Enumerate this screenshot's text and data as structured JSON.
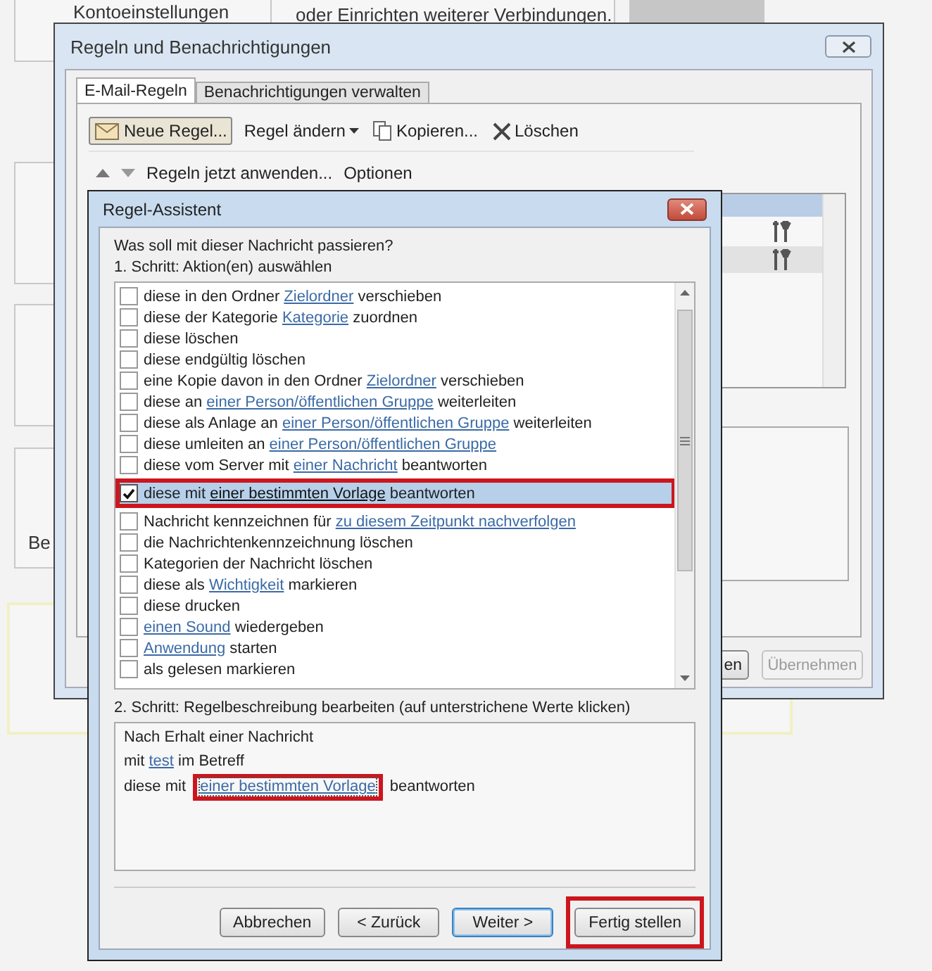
{
  "background": {
    "account_settings": "Kontoeinstellungen",
    "connections_text": "oder Einrichten weiterer Verbindungen.",
    "partial_label": "Be"
  },
  "rules_window": {
    "title": "Regeln und Benachrichtigungen",
    "tabs": [
      {
        "label": "E-Mail-Regeln",
        "selected": true
      },
      {
        "label": "Benachrichtigungen verwalten",
        "selected": false
      }
    ],
    "toolbar": [
      {
        "label": "Neue Regel...",
        "kind": "new"
      },
      {
        "label": "Regel ändern",
        "kind": "dropdown"
      },
      {
        "label": "Kopieren...",
        "kind": "copy"
      },
      {
        "label": "Löschen",
        "kind": "delete"
      }
    ],
    "commands": [
      "Regeln jetzt anwenden...",
      "Optionen"
    ],
    "buttons": [
      {
        "label": "en",
        "disabled": false
      },
      {
        "label": "Übernehmen",
        "disabled": true
      }
    ]
  },
  "wizard": {
    "title": "Regel-Assistent",
    "question": "Was soll mit dieser Nachricht passieren?",
    "step1": "1. Schritt: Aktion(en) auswählen",
    "actions": [
      {
        "checked": false,
        "selected": false,
        "highlighted": false,
        "parts": [
          {
            "text": "diese in den Ordner ",
            "link": false
          },
          {
            "text": "Zielordner",
            "link": true
          },
          {
            "text": " verschieben",
            "link": false
          }
        ]
      },
      {
        "checked": false,
        "selected": false,
        "highlighted": false,
        "parts": [
          {
            "text": "diese der Kategorie ",
            "link": false
          },
          {
            "text": "Kategorie",
            "link": true
          },
          {
            "text": " zuordnen",
            "link": false
          }
        ]
      },
      {
        "checked": false,
        "selected": false,
        "highlighted": false,
        "parts": [
          {
            "text": "diese löschen",
            "link": false
          }
        ]
      },
      {
        "checked": false,
        "selected": false,
        "highlighted": false,
        "parts": [
          {
            "text": "diese endgültig löschen",
            "link": false
          }
        ]
      },
      {
        "checked": false,
        "selected": false,
        "highlighted": false,
        "parts": [
          {
            "text": "eine Kopie davon in den Ordner ",
            "link": false
          },
          {
            "text": "Zielordner",
            "link": true
          },
          {
            "text": " verschieben",
            "link": false
          }
        ]
      },
      {
        "checked": false,
        "selected": false,
        "highlighted": false,
        "parts": [
          {
            "text": "diese an ",
            "link": false
          },
          {
            "text": "einer Person/öffentlichen Gruppe",
            "link": true
          },
          {
            "text": " weiterleiten",
            "link": false
          }
        ]
      },
      {
        "checked": false,
        "selected": false,
        "highlighted": false,
        "parts": [
          {
            "text": "diese als Anlage an ",
            "link": false
          },
          {
            "text": "einer Person/öffentlichen Gruppe",
            "link": true
          },
          {
            "text": " weiterleiten",
            "link": false
          }
        ]
      },
      {
        "checked": false,
        "selected": false,
        "highlighted": false,
        "parts": [
          {
            "text": "diese umleiten an ",
            "link": false
          },
          {
            "text": "einer Person/öffentlichen Gruppe",
            "link": true
          }
        ]
      },
      {
        "checked": false,
        "selected": false,
        "highlighted": false,
        "parts": [
          {
            "text": "diese vom Server mit ",
            "link": false
          },
          {
            "text": "einer Nachricht",
            "link": true
          },
          {
            "text": " beantworten",
            "link": false
          }
        ]
      },
      {
        "checked": true,
        "selected": true,
        "highlighted": true,
        "parts": [
          {
            "text": "diese mit ",
            "link": false
          },
          {
            "text": "einer bestimmten Vorlage",
            "link": true
          },
          {
            "text": " beantworten",
            "link": false
          }
        ]
      },
      {
        "checked": false,
        "selected": false,
        "highlighted": false,
        "parts": [
          {
            "text": "Nachricht kennzeichnen für ",
            "link": false
          },
          {
            "text": "zu diesem Zeitpunkt nachverfolgen",
            "link": true
          }
        ]
      },
      {
        "checked": false,
        "selected": false,
        "highlighted": false,
        "parts": [
          {
            "text": "die Nachrichtenkennzeichnung löschen",
            "link": false
          }
        ]
      },
      {
        "checked": false,
        "selected": false,
        "highlighted": false,
        "parts": [
          {
            "text": "Kategorien der Nachricht löschen",
            "link": false
          }
        ]
      },
      {
        "checked": false,
        "selected": false,
        "highlighted": false,
        "parts": [
          {
            "text": "diese als ",
            "link": false
          },
          {
            "text": "Wichtigkeit",
            "link": true
          },
          {
            "text": " markieren",
            "link": false
          }
        ]
      },
      {
        "checked": false,
        "selected": false,
        "highlighted": false,
        "parts": [
          {
            "text": "diese drucken",
            "link": false
          }
        ]
      },
      {
        "checked": false,
        "selected": false,
        "highlighted": false,
        "parts": [
          {
            "text": "einen Sound",
            "link": true
          },
          {
            "text": " wiedergeben",
            "link": false
          }
        ]
      },
      {
        "checked": false,
        "selected": false,
        "highlighted": false,
        "parts": [
          {
            "text": "Anwendung",
            "link": true
          },
          {
            "text": " starten",
            "link": false
          }
        ]
      },
      {
        "checked": false,
        "selected": false,
        "highlighted": false,
        "parts": [
          {
            "text": "als gelesen markieren",
            "link": false
          }
        ]
      }
    ],
    "step2": "2. Schritt: Regelbeschreibung bearbeiten (auf unterstrichene Werte klicken)",
    "description": [
      [
        {
          "text": "Nach Erhalt einer Nachricht",
          "link": false,
          "highlighted": false
        }
      ],
      [
        {
          "text": "mit ",
          "link": false,
          "highlighted": false
        },
        {
          "text": "test",
          "link": true,
          "highlighted": false
        },
        {
          "text": " im Betreff",
          "link": false,
          "highlighted": false
        }
      ],
      [
        {
          "text": "diese mit ",
          "link": false,
          "highlighted": false
        },
        {
          "text": "einer bestimmten Vorlage",
          "link": true,
          "highlighted": true
        },
        {
          "text": " beantworten",
          "link": false,
          "highlighted": false
        }
      ]
    ],
    "buttons": [
      {
        "label": "Abbrechen",
        "default": false,
        "highlighted": false
      },
      {
        "label": "< Zurück",
        "default": false,
        "highlighted": false
      },
      {
        "label": "Weiter >",
        "default": true,
        "highlighted": false
      },
      {
        "label": "Fertig stellen",
        "default": false,
        "highlighted": true
      }
    ]
  }
}
